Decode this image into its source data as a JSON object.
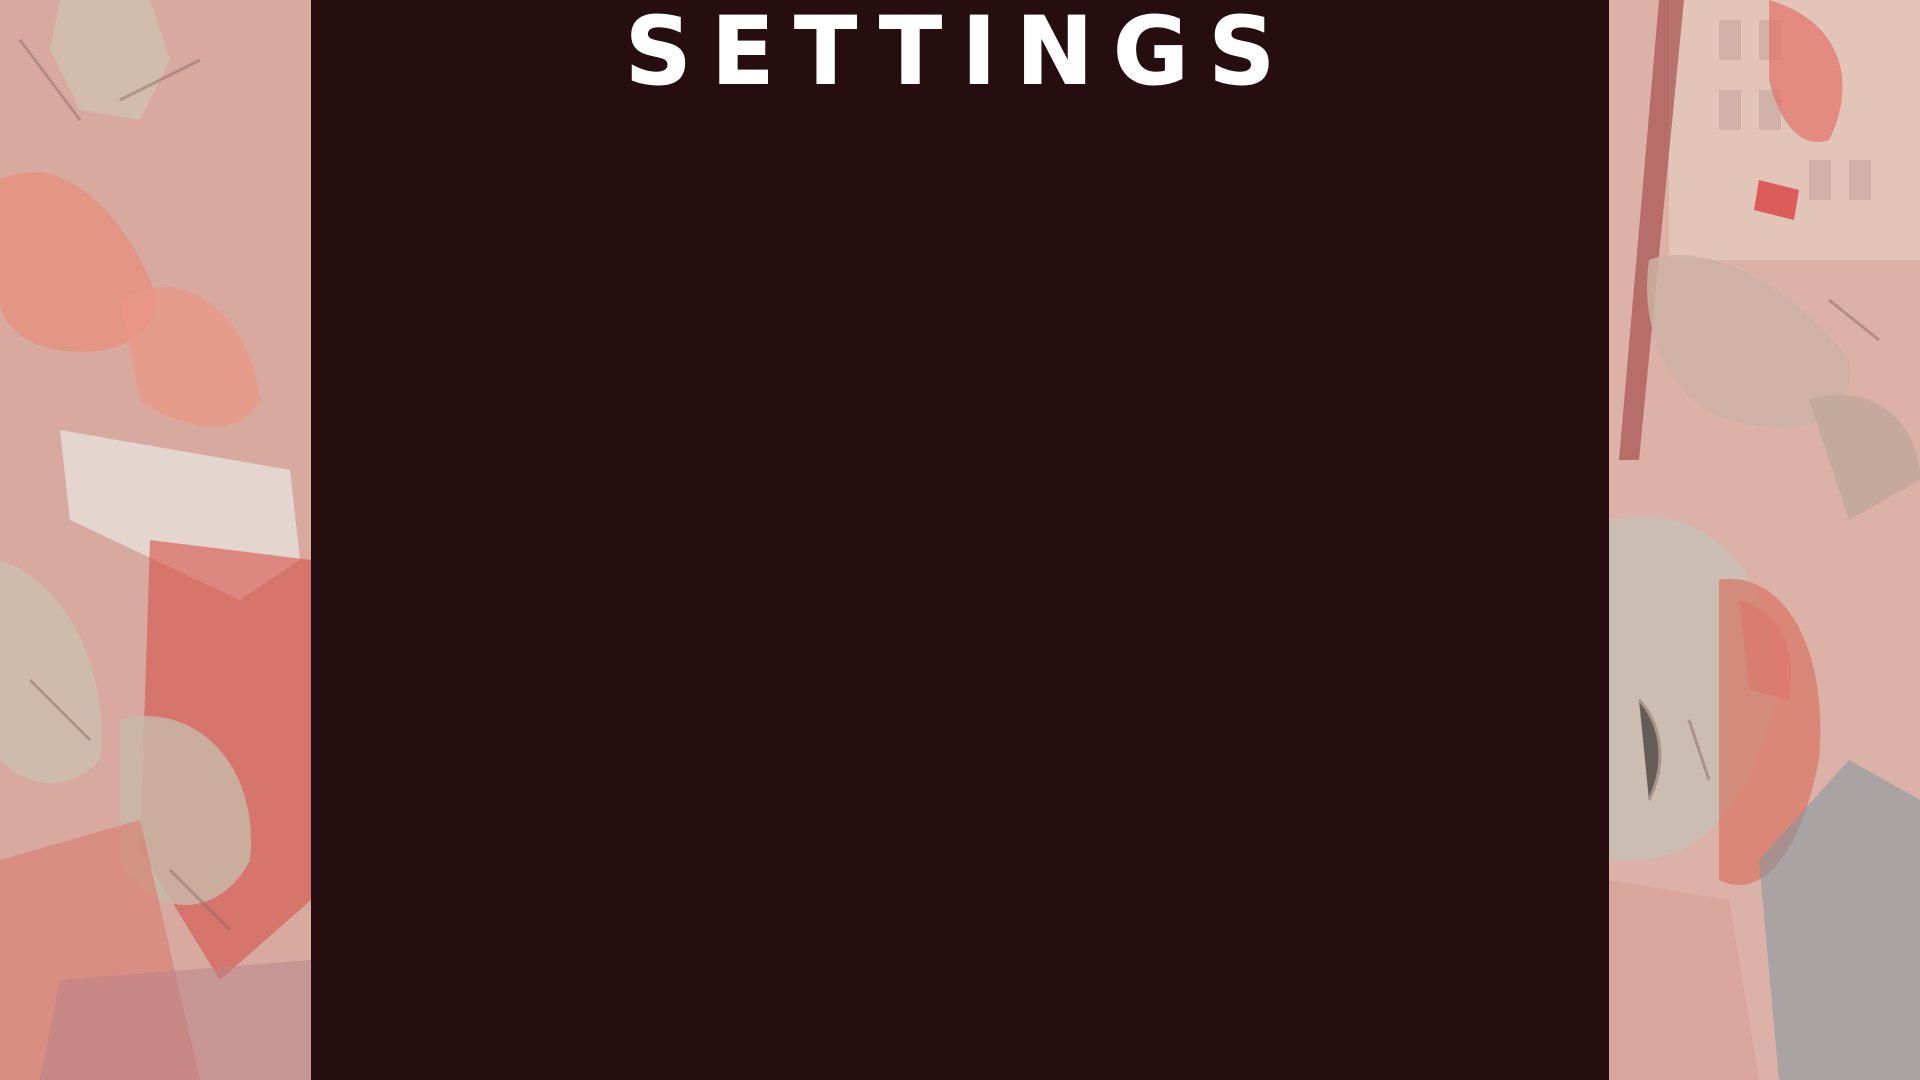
{
  "screen": {
    "title": "SETTINGS"
  },
  "background": {
    "left_art": "zombie-horde-illustration",
    "right_art": "zombie-horde-city-illustration"
  },
  "colors": {
    "panel": "#260e10",
    "title": "#ffffff",
    "art_wash": "#dcaea2"
  }
}
